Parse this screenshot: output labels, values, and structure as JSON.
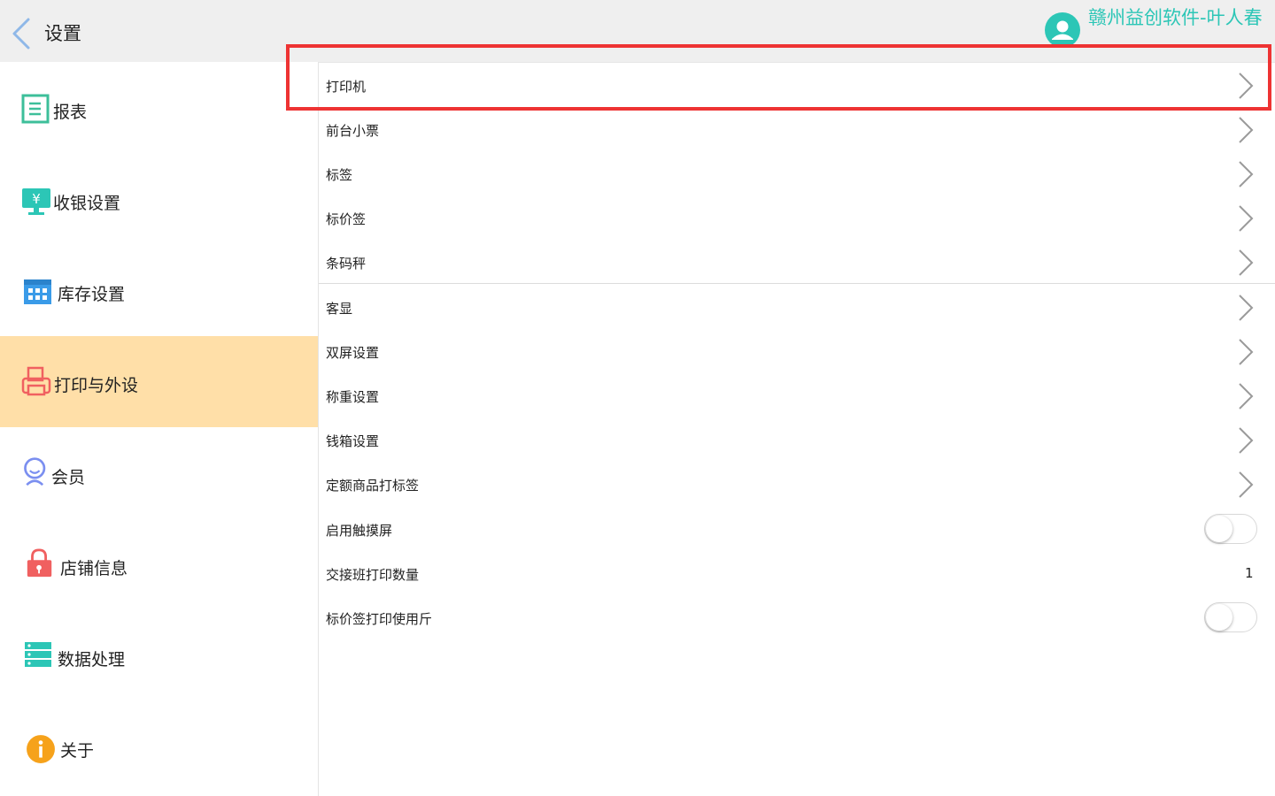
{
  "header": {
    "title": "设置",
    "user_name": "赣州益创软件-叶人春"
  },
  "sidebar": {
    "items": [
      {
        "label": "报表",
        "icon": "report-icon"
      },
      {
        "label": "收银设置",
        "icon": "cashier-icon"
      },
      {
        "label": "库存设置",
        "icon": "inventory-icon"
      },
      {
        "label": "打印与外设",
        "icon": "printer-icon",
        "active": true
      },
      {
        "label": "会员",
        "icon": "member-icon"
      },
      {
        "label": "店铺信息",
        "icon": "store-lock-icon"
      },
      {
        "label": "数据处理",
        "icon": "data-icon"
      },
      {
        "label": "关于",
        "icon": "info-icon"
      }
    ]
  },
  "settings": {
    "rows": [
      {
        "label": "打印机"
      },
      {
        "label": "前台小票"
      },
      {
        "label": "标签"
      },
      {
        "label": "标价签"
      },
      {
        "label": "条码秤"
      },
      {
        "label": "客显"
      },
      {
        "label": "双屏设置"
      },
      {
        "label": "称重设置"
      },
      {
        "label": "钱箱设置"
      },
      {
        "label": "定额商品打标签"
      },
      {
        "label": "启用触摸屏",
        "toggle": false
      },
      {
        "label": "交接班打印数量",
        "value": "1"
      },
      {
        "label": "标价签打印使用斤",
        "toggle": false
      }
    ]
  },
  "colors": {
    "accent": "#2cc6b6",
    "active_bg": "#ffdfa8",
    "highlight": "#ee3333"
  }
}
